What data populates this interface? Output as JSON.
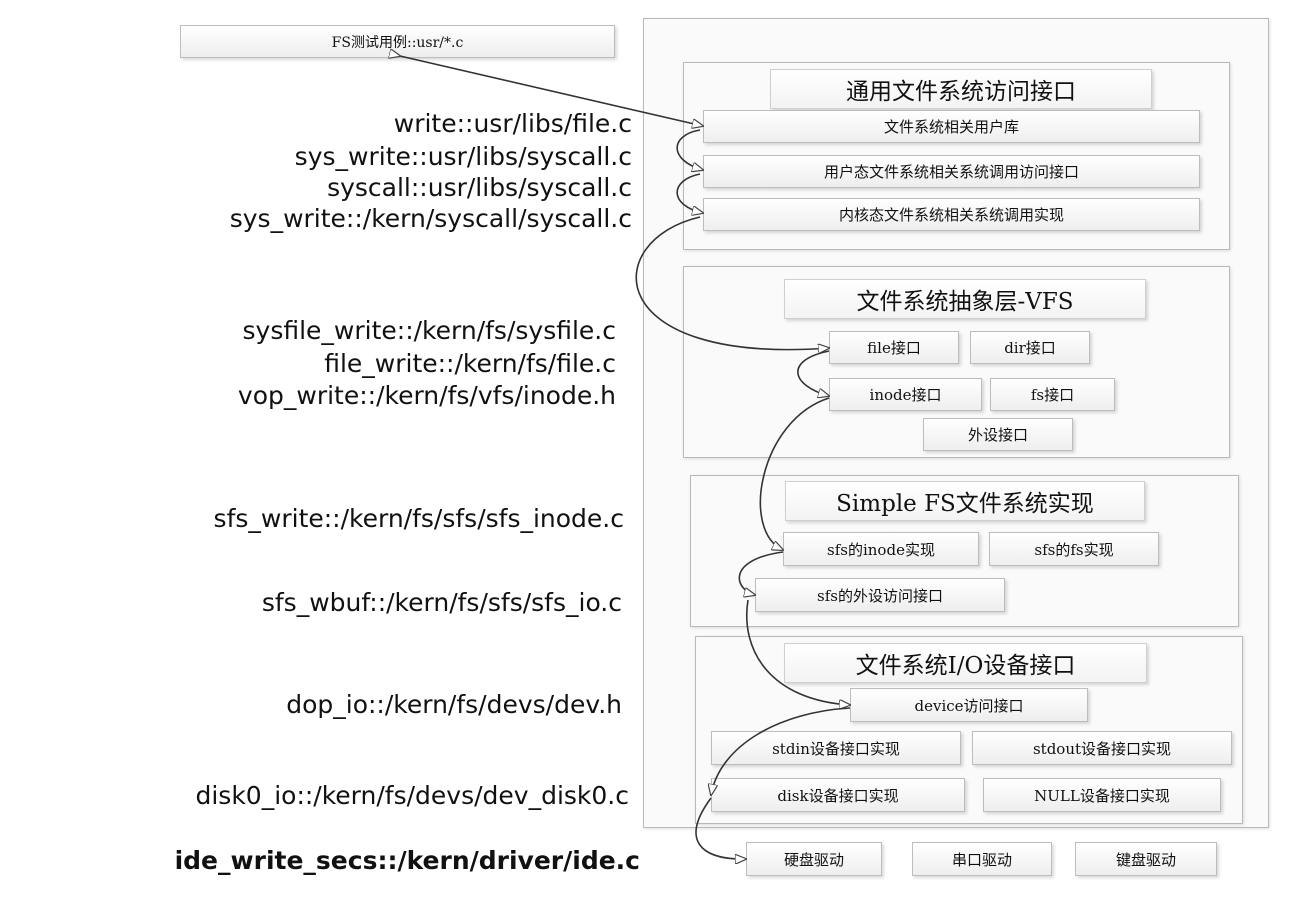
{
  "test_case": "FS测试用例::usr/*.c",
  "layers": {
    "general": {
      "title": "通用文件系统访问接口",
      "items": [
        "文件系统相关用户库",
        "用户态文件系统相关系统调用访问接口",
        "内核态文件系统相关系统调用实现"
      ]
    },
    "vfs": {
      "title": "文件系统抽象层-VFS",
      "items": [
        "file接口",
        "dir接口",
        "inode接口",
        "fs接口",
        "外设接口"
      ]
    },
    "sfs": {
      "title": "Simple FS文件系统实现",
      "items": [
        "sfs的inode实现",
        "sfs的fs实现",
        "sfs的外设访问接口"
      ]
    },
    "io": {
      "title": "文件系统I/O设备接口",
      "items": [
        "device访问接口",
        "stdin设备接口实现",
        "stdout设备接口实现",
        "disk设备接口实现",
        "NULL设备接口实现"
      ]
    }
  },
  "drivers": [
    "硬盘驱动",
    "串口驱动",
    "键盘驱动"
  ],
  "call_chain": {
    "write": "write::usr/libs/file.c",
    "sys_write_user": "sys_write::usr/libs/syscall.c",
    "syscall": "syscall::usr/libs/syscall.c",
    "sys_write_kern": "sys_write::/kern/syscall/syscall.c",
    "sysfile_write": "sysfile_write::/kern/fs/sysfile.c",
    "file_write": "file_write::/kern/fs/file.c",
    "vop_write": "vop_write::/kern/fs/vfs/inode.h",
    "sfs_write": "sfs_write::/kern/fs/sfs/sfs_inode.c",
    "sfs_wbuf": "sfs_wbuf::/kern/fs/sfs/sfs_io.c",
    "dop_io": "dop_io::/kern/fs/devs/dev.h",
    "disk0_io": "disk0_io::/kern/fs/devs/dev_disk0.c",
    "ide_write_secs": "ide_write_secs::/kern/driver/ide.c"
  }
}
